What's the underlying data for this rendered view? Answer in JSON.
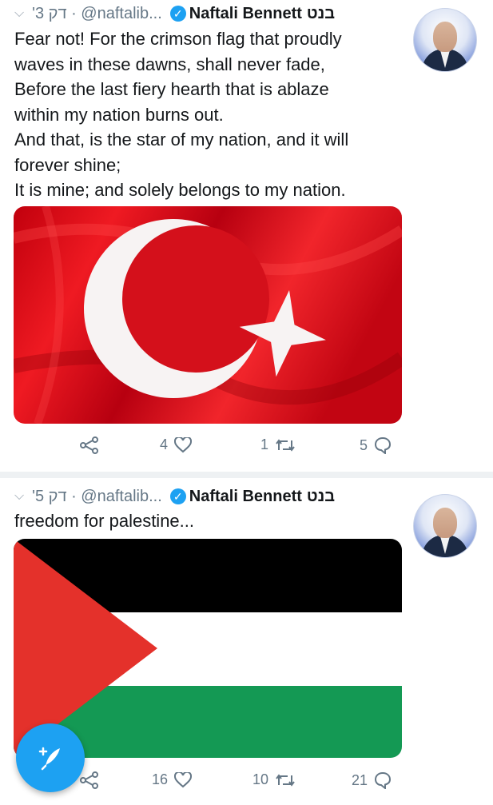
{
  "tweets": [
    {
      "meta": "'3 דק · @naftalib...",
      "name": "Naftali Bennett",
      "hebrew_name": "בנט",
      "text_lines": [
        "Fear not! For the crimson flag that proudly",
        "waves in these dawns, shall never fade,",
        "Before the last fiery hearth that is ablaze",
        "within my nation burns out.",
        "And that, is the star of my nation, and it will",
        "forever shine;",
        "It is mine; and solely belongs to my nation."
      ],
      "media": "turkish-flag-image",
      "likes": "4",
      "retweets": "1",
      "replies": "5"
    },
    {
      "meta": "'5 דק · @naftalib...",
      "name": "Naftali Bennett",
      "hebrew_name": "בנט",
      "text_lines": [
        "freedom for palestine..."
      ],
      "media": "palestinian-flag-image",
      "likes": "16",
      "retweets": "10",
      "replies": "21"
    }
  ],
  "colors": {
    "accent": "#1da1f2",
    "turkish_red": "#e30a17",
    "palestine_black": "#000000",
    "palestine_green": "#149954",
    "palestine_red": "#e4312b"
  },
  "icons": {
    "verified": "verified-badge-icon",
    "share": "share-icon",
    "like": "heart-icon",
    "retweet": "retweet-icon",
    "reply": "reply-icon",
    "compose": "compose-tweet-icon"
  }
}
